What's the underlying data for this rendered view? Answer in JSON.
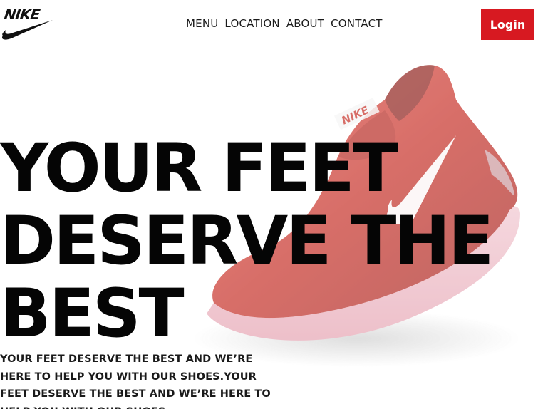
{
  "brand": {
    "logo_text": "NIKE"
  },
  "nav": {
    "items": [
      "MENU",
      "LOCATION",
      "ABOUT",
      "CONTACT"
    ]
  },
  "header": {
    "login_label": "Login"
  },
  "hero": {
    "title_lines": [
      "YOUR FEET",
      "DESERVE THE",
      "BEST"
    ],
    "subtitle": "YOUR FEET DESERVE THE BEST AND WE’RE HERE TO HELP YOU WITH OUR SHOES.YOUR FEET DESERVE THE BEST AND WE’RE HERE TO HELP YOU WITH OUR SHOES."
  },
  "colors": {
    "accent": "#d71921",
    "text": "#050505",
    "background": "#ffffff",
    "shoe": "#c8413a"
  }
}
